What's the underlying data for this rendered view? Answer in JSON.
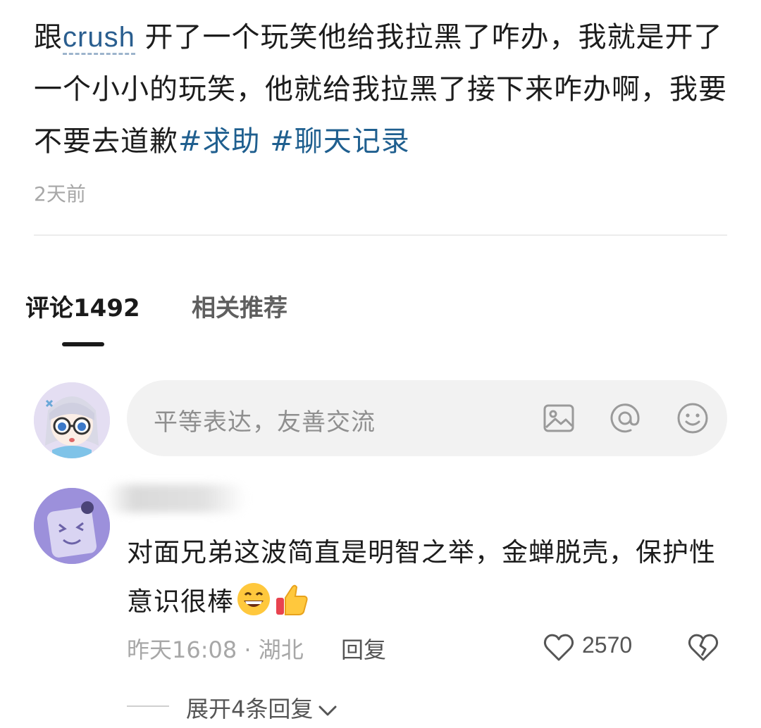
{
  "post": {
    "text_before": "跟",
    "crush_word": "crush",
    "text_main": " 开了一个玩笑他给我拉黑了咋办，我就是开了一个小小的玩笑，他就给我拉黑了接下来咋办啊，我要不要去道歉",
    "tags": [
      "#求助",
      "#聊天记录"
    ],
    "time": "2天前"
  },
  "tabs": {
    "comments": "评论1492",
    "related": "相关推荐"
  },
  "comment_input": {
    "placeholder": "平等表达，友善交流",
    "icons": [
      "image-icon",
      "at-icon",
      "smiley-icon"
    ]
  },
  "comment": {
    "text": "对面兄弟这波简直是明智之举，金蝉脱壳，保护性意识很棒",
    "emojis": [
      "grinning-face-emoji",
      "thumbs-up-emoji"
    ],
    "time_location": "昨天16:08 · 湖北",
    "reply_label": "回复",
    "likes": "2570",
    "expand_label": "展开4条回复"
  },
  "colors": {
    "hashtag": "#1f5f8f",
    "muted_text": "#a7a7a7",
    "input_bg": "#f2f2f2"
  }
}
